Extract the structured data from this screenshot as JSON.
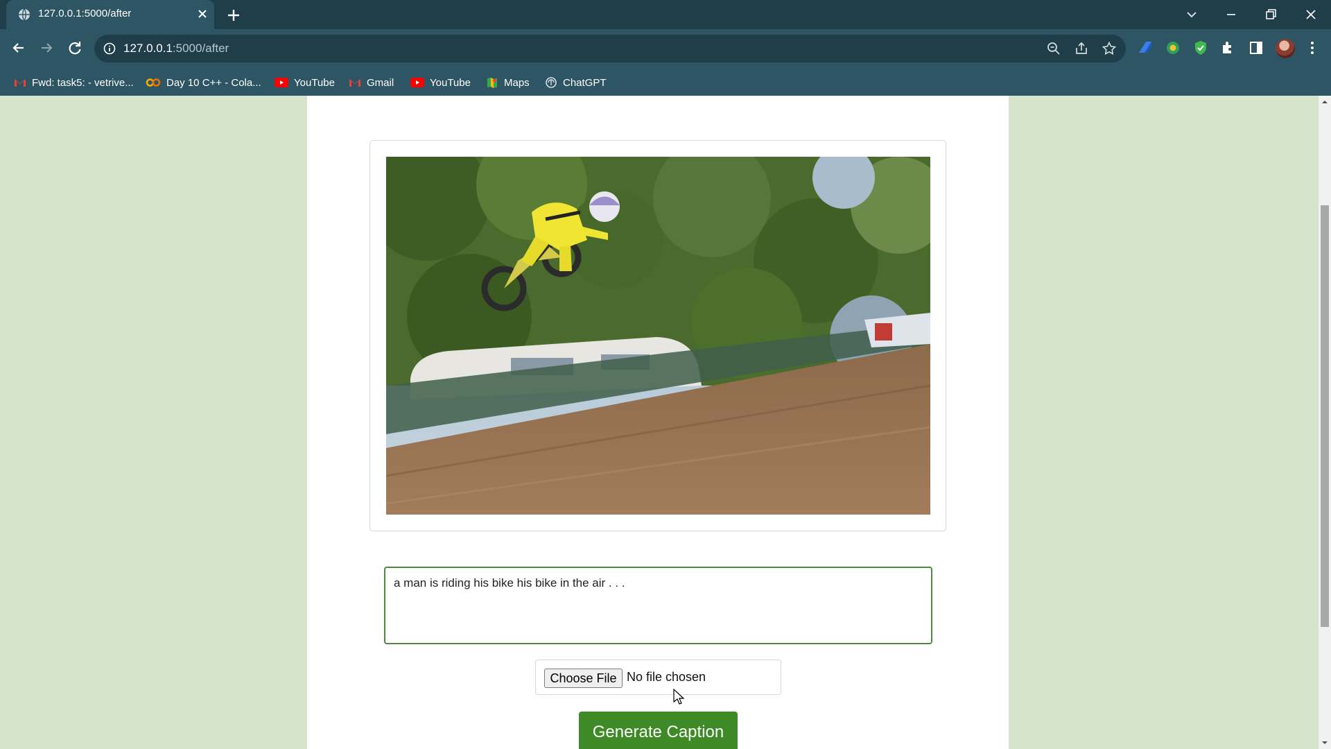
{
  "browser": {
    "tab": {
      "title": "127.0.0.1:5000/after",
      "favicon": "globe-icon"
    },
    "address": {
      "host": "127.0.0.1",
      "rest": ":5000/after"
    },
    "bookmarks": [
      {
        "label": "Fwd: task5: - vetrive...",
        "icon": "gmail-icon"
      },
      {
        "label": "Day 10 C++ - Cola...",
        "icon": "colab-icon"
      },
      {
        "label": "YouTube",
        "icon": "youtube-icon"
      },
      {
        "label": "Gmail",
        "icon": "gmail-icon"
      },
      {
        "label": "YouTube",
        "icon": "youtube-icon"
      },
      {
        "label": "Maps",
        "icon": "maps-icon"
      },
      {
        "label": "ChatGPT",
        "icon": "chatgpt-icon"
      }
    ],
    "colors": {
      "tabbar": "#1f3e4a",
      "toolbar": "#2d5563"
    }
  },
  "page": {
    "photo_description_icon": "uploaded-image",
    "caption_text": "a man is riding his bike his bike in the air . . .",
    "file_input": {
      "button_label": "Choose File",
      "status": "No file chosen"
    },
    "generate_button_label": "Generate Caption",
    "colors": {
      "background": "#d6e4cc",
      "accent": "#3e8a26",
      "caption_border": "#4a8a3a"
    }
  }
}
